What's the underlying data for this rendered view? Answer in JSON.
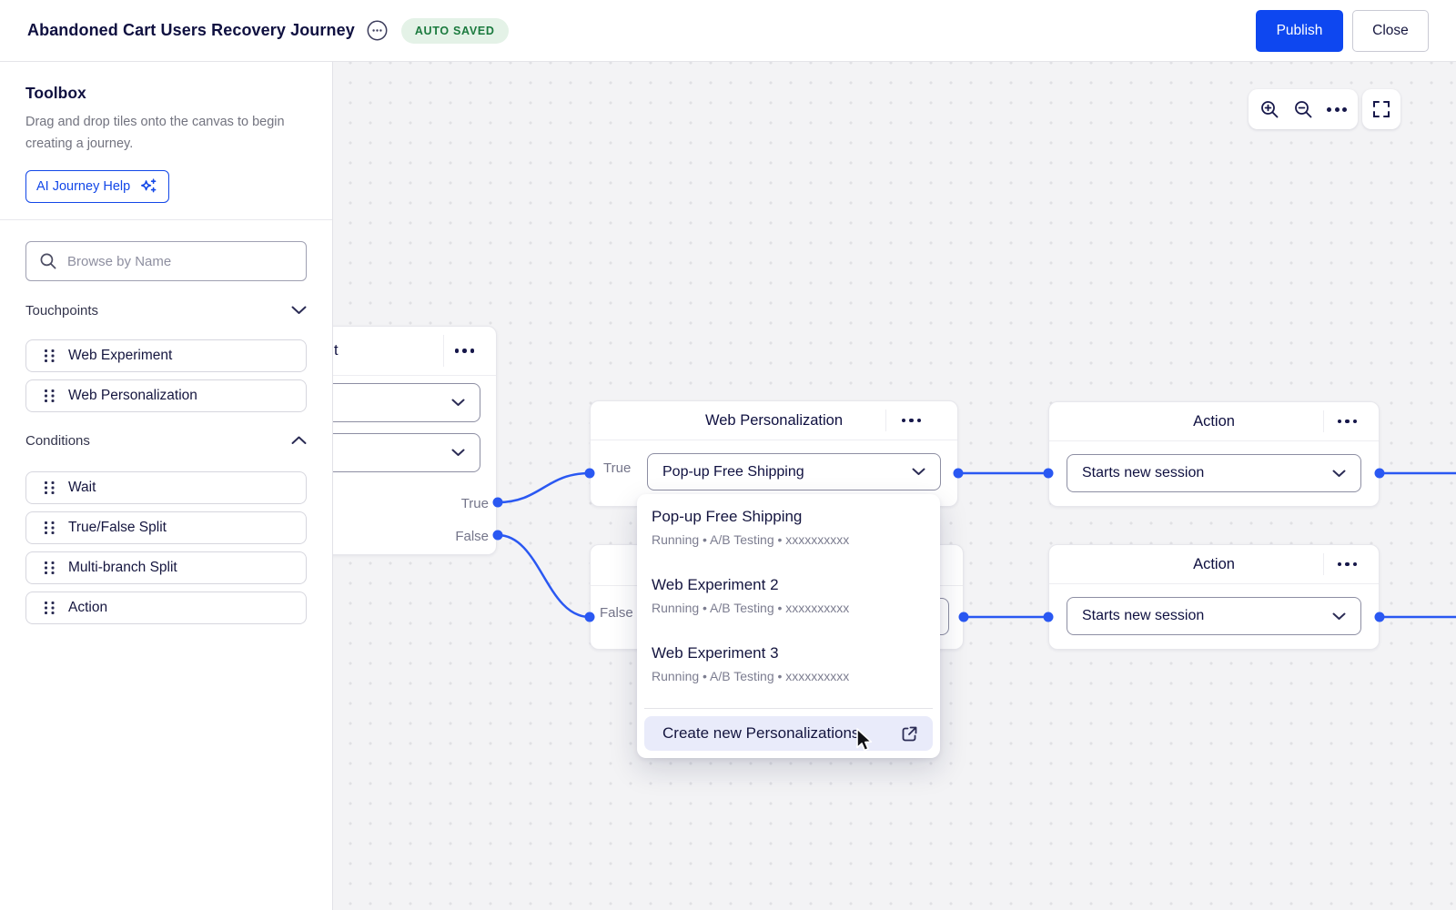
{
  "header": {
    "title": "Abandoned Cart Users Recovery Journey",
    "status_badge": "AUTO SAVED",
    "publish_button": "Publish",
    "close_button": "Close"
  },
  "toolbox": {
    "title": "Toolbox",
    "description": "Drag and drop tiles onto the canvas to begin creating a journey.",
    "ai_help_button": "AI Journey Help",
    "search_placeholder": "Browse by Name",
    "sections": [
      {
        "label": "Touchpoints",
        "state": "expanded",
        "tiles": [
          {
            "label": "Web Experiment"
          },
          {
            "label": "Web Personalization"
          }
        ]
      },
      {
        "label": "Conditions",
        "state": "expanded",
        "tiles": [
          {
            "label": "Wait"
          },
          {
            "label": "True/False Split"
          },
          {
            "label": "Multi-branch Split"
          },
          {
            "label": "Action"
          }
        ]
      }
    ]
  },
  "canvas": {
    "controls": {
      "icons": [
        "zoom-in",
        "zoom-out",
        "more-options",
        "fullscreen"
      ]
    },
    "nodes": {
      "split": {
        "visible_title": "t",
        "true_port": "True",
        "false_port": "False"
      },
      "web_personalization": {
        "title": "Web Personalization",
        "input_label": "True",
        "select_value": "Pop-up Free Shipping"
      },
      "false_branch": {
        "input_label": "False"
      },
      "action_top": {
        "title": "Action",
        "select_value": "Starts new session"
      },
      "action_bottom": {
        "title": "Action",
        "select_value": "Starts new session"
      }
    },
    "personalization_menu": {
      "items": [
        {
          "title": "Pop-up Free Shipping",
          "subtitle": "Running • A/B Testing • xxxxxxxxxx"
        },
        {
          "title": "Web Experiment 2",
          "subtitle": "Running • A/B Testing • xxxxxxxxxx"
        },
        {
          "title": "Web Experiment 3",
          "subtitle": "Running • A/B Testing • xxxxxxxxxx"
        }
      ],
      "create_action": "Create new Personalizations"
    }
  },
  "colors": {
    "accent_blue": "#0e47f0",
    "connector_blue": "#2a58f2",
    "badge_green_text": "#1b7a3e",
    "badge_green_bg": "#e4f2e7",
    "navy_text": "#0f1040"
  }
}
